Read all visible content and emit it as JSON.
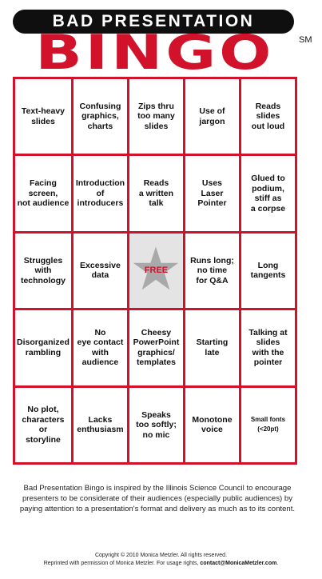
{
  "header": {
    "title": "BAD PRESENTATION",
    "logo_word": "BINGO",
    "service_mark": "SM"
  },
  "colors": {
    "accent_red": "#d1122a",
    "banner_black": "#0f0f0f",
    "free_cell_gray": "#e4e4e4",
    "star_gray": "#a9a9a9"
  },
  "grid": {
    "rows": [
      [
        "Text-heavy\nslides",
        "Confusing\ngraphics,\ncharts",
        "Zips thru\ntoo many\nslides",
        "Use of\njargon",
        "Reads\nslides\nout loud"
      ],
      [
        "Facing screen,\nnot audience",
        "Introduction\nof\nintroducers",
        "Reads\na written\ntalk",
        "Uses\nLaser\nPointer",
        "Glued to\npodium,\nstiff as\na corpse"
      ],
      [
        "Struggles\nwith\ntechnology",
        "Excessive\ndata",
        "FREE",
        "Runs long;\nno time\nfor Q&A",
        "Long\ntangents"
      ],
      [
        "Disorganized\nrambling",
        "No\neye contact\nwith\naudience",
        "Cheesy\nPowerPoint\ngraphics/\ntemplates",
        "Starting\nlate",
        "Talking at\nslides\nwith the\npointer"
      ],
      [
        "No plot,\ncharacters\nor\nstoryline",
        "Lacks\nenthusiasm",
        "Speaks\ntoo softly;\nno mic",
        "Monotone\nvoice",
        "Small fonts\n(<20pt)"
      ]
    ],
    "free_icon": "star-icon"
  },
  "footer": {
    "description": "Bad Presentation Bingo is inspired by the Illinois Science Council to encourage presenters  to be considerate of their audiences (especially public audiences) by paying attention to a presentation's format and delivery as much as to its content.",
    "copyright": "Copyright © 2010 Monica Metzler. All rights reserved.",
    "permission": "Reprinted with permission of Monica Metzler. For usage rights, ",
    "contact": "contact@MonicaMetzler.com",
    "period": "."
  }
}
